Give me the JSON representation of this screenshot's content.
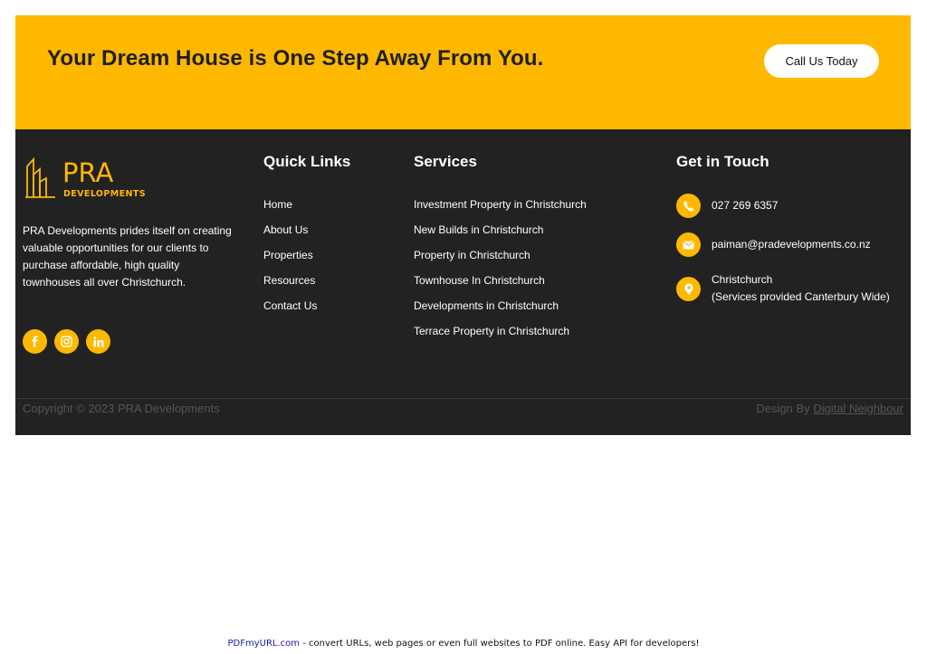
{
  "cta": {
    "title": "Your Dream House is One Step Away From You.",
    "button_label": "Call Us Today"
  },
  "footer": {
    "logo": {
      "name": "PRA",
      "tagline": "DEVELOPMENTS"
    },
    "about_text": "PRA Developments prides itself on creating valuable opportunities for our clients to purchase affordable, high quality townhouses all over Christchurch.",
    "socials": [
      "facebook-icon",
      "instagram-icon",
      "linkedin-icon"
    ],
    "quick_links": {
      "title": "Quick Links",
      "items": [
        "Home",
        "About Us",
        "Properties",
        "Resources",
        "Contact Us"
      ]
    },
    "services": {
      "title": "Services",
      "items": [
        "Investment Property in Christchurch",
        "New Builds in Christchurch",
        "Property in Christchurch",
        "Townhouse In Christchurch",
        "Developments in Christchurch",
        "Terrace Property in Christchurch"
      ]
    },
    "contact": {
      "title": "Get in Touch",
      "phone": "027 269 6357",
      "email": "paiman@pradevelopments.co.nz",
      "location": "Christchurch",
      "location_note": "(Services provided Canterbury Wide)"
    },
    "copyright": "Copyright © 2023 PRA Developments",
    "design_prefix": "Design By",
    "design_link": "Digital Neighbour"
  },
  "pdf_banner": {
    "link": "PDFmyURL.com",
    "text": " - convert URLs, web pages or even full websites to PDF online. Easy API for developers!"
  },
  "colors": {
    "accent": "#ffb800",
    "footer_bg": "#222222",
    "text": "#1f1f1f"
  }
}
